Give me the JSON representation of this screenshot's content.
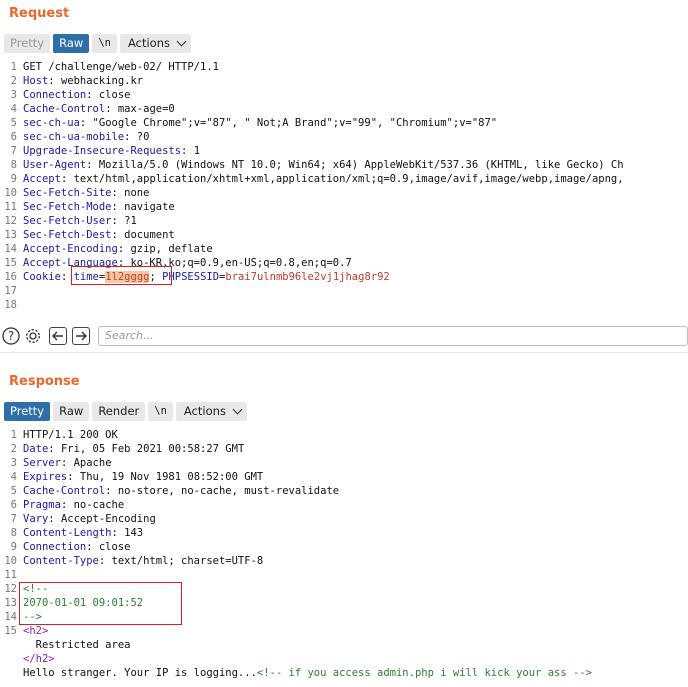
{
  "request": {
    "title": "Request",
    "tabs": [
      "Pretty",
      "Raw",
      "\\n",
      "Actions"
    ],
    "lines": [
      {
        "n": "1",
        "segs": [
          {
            "t": "GET /challenge/web-02/ HTTP/1.1",
            "c": ""
          }
        ]
      },
      {
        "n": "2",
        "segs": [
          {
            "t": "Host",
            "c": "hn"
          },
          {
            "t": ": webhacking.kr",
            "c": ""
          }
        ]
      },
      {
        "n": "3",
        "segs": [
          {
            "t": "Connection",
            "c": "hn"
          },
          {
            "t": ": close",
            "c": ""
          }
        ]
      },
      {
        "n": "4",
        "segs": [
          {
            "t": "Cache-Control",
            "c": "hn"
          },
          {
            "t": ": max-age=0",
            "c": ""
          }
        ]
      },
      {
        "n": "5",
        "segs": [
          {
            "t": "sec-ch-ua",
            "c": "hn"
          },
          {
            "t": ": \"Google Chrome\";v=\"87\", \" Not;A Brand\";v=\"99\", \"Chromium\";v=\"87\"",
            "c": ""
          }
        ]
      },
      {
        "n": "6",
        "segs": [
          {
            "t": "sec-ch-ua-mobile",
            "c": "hn"
          },
          {
            "t": ": ?0",
            "c": ""
          }
        ]
      },
      {
        "n": "7",
        "segs": [
          {
            "t": "Upgrade-Insecure-Requests",
            "c": "hn"
          },
          {
            "t": ": 1",
            "c": ""
          }
        ]
      },
      {
        "n": "8",
        "segs": [
          {
            "t": "User-Agent",
            "c": "hn"
          },
          {
            "t": ": Mozilla/5.0 (Windows NT 10.0; Win64; x64) AppleWebKit/537.36 (KHTML, like Gecko) Ch",
            "c": ""
          }
        ]
      },
      {
        "n": "9",
        "segs": [
          {
            "t": "Accept",
            "c": "hn"
          },
          {
            "t": ": text/html,application/xhtml+xml,application/xml;q=0.9,image/avif,image/webp,image/apng,",
            "c": ""
          }
        ]
      },
      {
        "n": "10",
        "segs": [
          {
            "t": "Sec-Fetch-Site",
            "c": "hn"
          },
          {
            "t": ": none",
            "c": ""
          }
        ]
      },
      {
        "n": "11",
        "segs": [
          {
            "t": "Sec-Fetch-Mode",
            "c": "hn"
          },
          {
            "t": ": navigate",
            "c": ""
          }
        ]
      },
      {
        "n": "12",
        "segs": [
          {
            "t": "Sec-Fetch-User",
            "c": "hn"
          },
          {
            "t": ": ?1",
            "c": ""
          }
        ]
      },
      {
        "n": "13",
        "segs": [
          {
            "t": "Sec-Fetch-Dest",
            "c": "hn"
          },
          {
            "t": ": document",
            "c": ""
          }
        ]
      },
      {
        "n": "14",
        "segs": [
          {
            "t": "Accept-Encoding",
            "c": "hn"
          },
          {
            "t": ": gzip, deflate",
            "c": ""
          }
        ]
      },
      {
        "n": "15",
        "segs": [
          {
            "t": "Accept-Language",
            "c": "hn"
          },
          {
            "t": ": ko-KR,ko;q=0.9,en-US;q=0.8,en;q=0.7",
            "c": ""
          }
        ]
      },
      {
        "n": "16",
        "segs": [
          {
            "t": "Cookie",
            "c": "hn"
          },
          {
            "t": ": ",
            "c": ""
          },
          {
            "t": "time",
            "c": "ck"
          },
          {
            "t": "=",
            "c": ""
          },
          {
            "t": "1l2gggg",
            "c": "hl"
          },
          {
            "t": ";",
            "c": ""
          },
          {
            "t": " ",
            "c": ""
          },
          {
            "t": "PHPSESSID",
            "c": "ck"
          },
          {
            "t": "=",
            "c": ""
          },
          {
            "t": "brai7ulnmb96le2vj1jhag8r92",
            "c": "cv"
          }
        ]
      },
      {
        "n": "17",
        "segs": []
      },
      {
        "n": "18",
        "segs": []
      }
    ]
  },
  "search": {
    "placeholder": "Search..."
  },
  "response": {
    "title": "Response",
    "tabs": [
      "Pretty",
      "Raw",
      "Render",
      "\\n",
      "Actions"
    ],
    "lines": [
      {
        "n": "1",
        "segs": [
          {
            "t": "HTTP/1.1 200 OK",
            "c": ""
          }
        ]
      },
      {
        "n": "2",
        "segs": [
          {
            "t": "Date",
            "c": "hn"
          },
          {
            "t": ": Fri, 05 Feb 2021 00:58:27 GMT",
            "c": ""
          }
        ]
      },
      {
        "n": "3",
        "segs": [
          {
            "t": "Server",
            "c": "hn"
          },
          {
            "t": ": Apache",
            "c": ""
          }
        ]
      },
      {
        "n": "4",
        "segs": [
          {
            "t": "Expires",
            "c": "hn"
          },
          {
            "t": ": Thu, 19 Nov 1981 08:52:00 GMT",
            "c": ""
          }
        ]
      },
      {
        "n": "5",
        "segs": [
          {
            "t": "Cache-Control",
            "c": "hn"
          },
          {
            "t": ": no-store, no-cache, must-revalidate",
            "c": ""
          }
        ]
      },
      {
        "n": "6",
        "segs": [
          {
            "t": "Pragma",
            "c": "hn"
          },
          {
            "t": ": no-cache",
            "c": ""
          }
        ]
      },
      {
        "n": "7",
        "segs": [
          {
            "t": "Vary",
            "c": "hn"
          },
          {
            "t": ": Accept-Encoding",
            "c": ""
          }
        ]
      },
      {
        "n": "8",
        "segs": [
          {
            "t": "Content-Length",
            "c": "hn"
          },
          {
            "t": ": 143",
            "c": ""
          }
        ]
      },
      {
        "n": "9",
        "segs": [
          {
            "t": "Connection",
            "c": "hn"
          },
          {
            "t": ": close",
            "c": ""
          }
        ]
      },
      {
        "n": "10",
        "segs": [
          {
            "t": "Content-Type",
            "c": "hn"
          },
          {
            "t": ": text/html; charset=UTF-8",
            "c": ""
          }
        ]
      },
      {
        "n": "11",
        "segs": []
      },
      {
        "n": "12",
        "segs": [
          {
            "t": "<!--",
            "c": "cm"
          }
        ]
      },
      {
        "n": "13",
        "segs": [
          {
            "t": "2070-01-01 09:01:52",
            "c": "cm"
          }
        ]
      },
      {
        "n": "14",
        "segs": [
          {
            "t": "-->",
            "c": "cm"
          }
        ]
      },
      {
        "n": "15",
        "segs": [
          {
            "t": "<h2>",
            "c": "tagc"
          }
        ]
      },
      {
        "n": "",
        "segs": [
          {
            "t": "  Restricted area",
            "c": ""
          }
        ]
      },
      {
        "n": "",
        "segs": [
          {
            "t": "</h2>",
            "c": "tagc"
          }
        ]
      },
      {
        "n": "",
        "segs": [
          {
            "t": "Hello stranger. Your IP is logging...",
            "c": ""
          },
          {
            "t": "<!-- if you access admin.php i will kick your ass -->",
            "c": "cm"
          }
        ]
      }
    ]
  },
  "colors": {
    "accent": "#e8692b",
    "active_tab": "#2f6fa7",
    "highlight_box": "#d81e1e"
  }
}
